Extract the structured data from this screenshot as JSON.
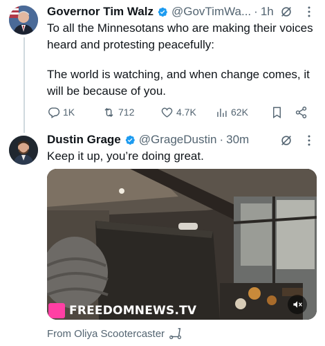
{
  "tweet1": {
    "name": "Governor Tim Walz",
    "handle": "@GovTimWa...",
    "dot": "·",
    "time": "1h",
    "text_line1": "To all the Minnesotans who are making their voices heard and protesting peacefully:",
    "text_line2": "The world is watching, and when change comes, it will be because of you.",
    "replies": "1K",
    "reposts": "712",
    "likes": "4.7K",
    "views": "62K"
  },
  "tweet2": {
    "name": "Dustin Grage",
    "handle": "@GrageDustin",
    "dot": "·",
    "time": "30m",
    "text": "Keep it up, you’re doing great.",
    "video": {
      "watermark": "FREEDOMNEWS.TV"
    },
    "from": "From Oliya Scootercaster"
  },
  "colors": {
    "verified": "#1d9bf0",
    "secondary_text": "#536471",
    "watermark_pink": "#ff3fa4"
  },
  "icons": [
    "verified-badge-icon",
    "grok-icon",
    "more-icon",
    "reply-icon",
    "repost-icon",
    "like-icon",
    "views-icon",
    "bookmark-icon",
    "share-icon",
    "mute-icon",
    "scooter-icon"
  ]
}
